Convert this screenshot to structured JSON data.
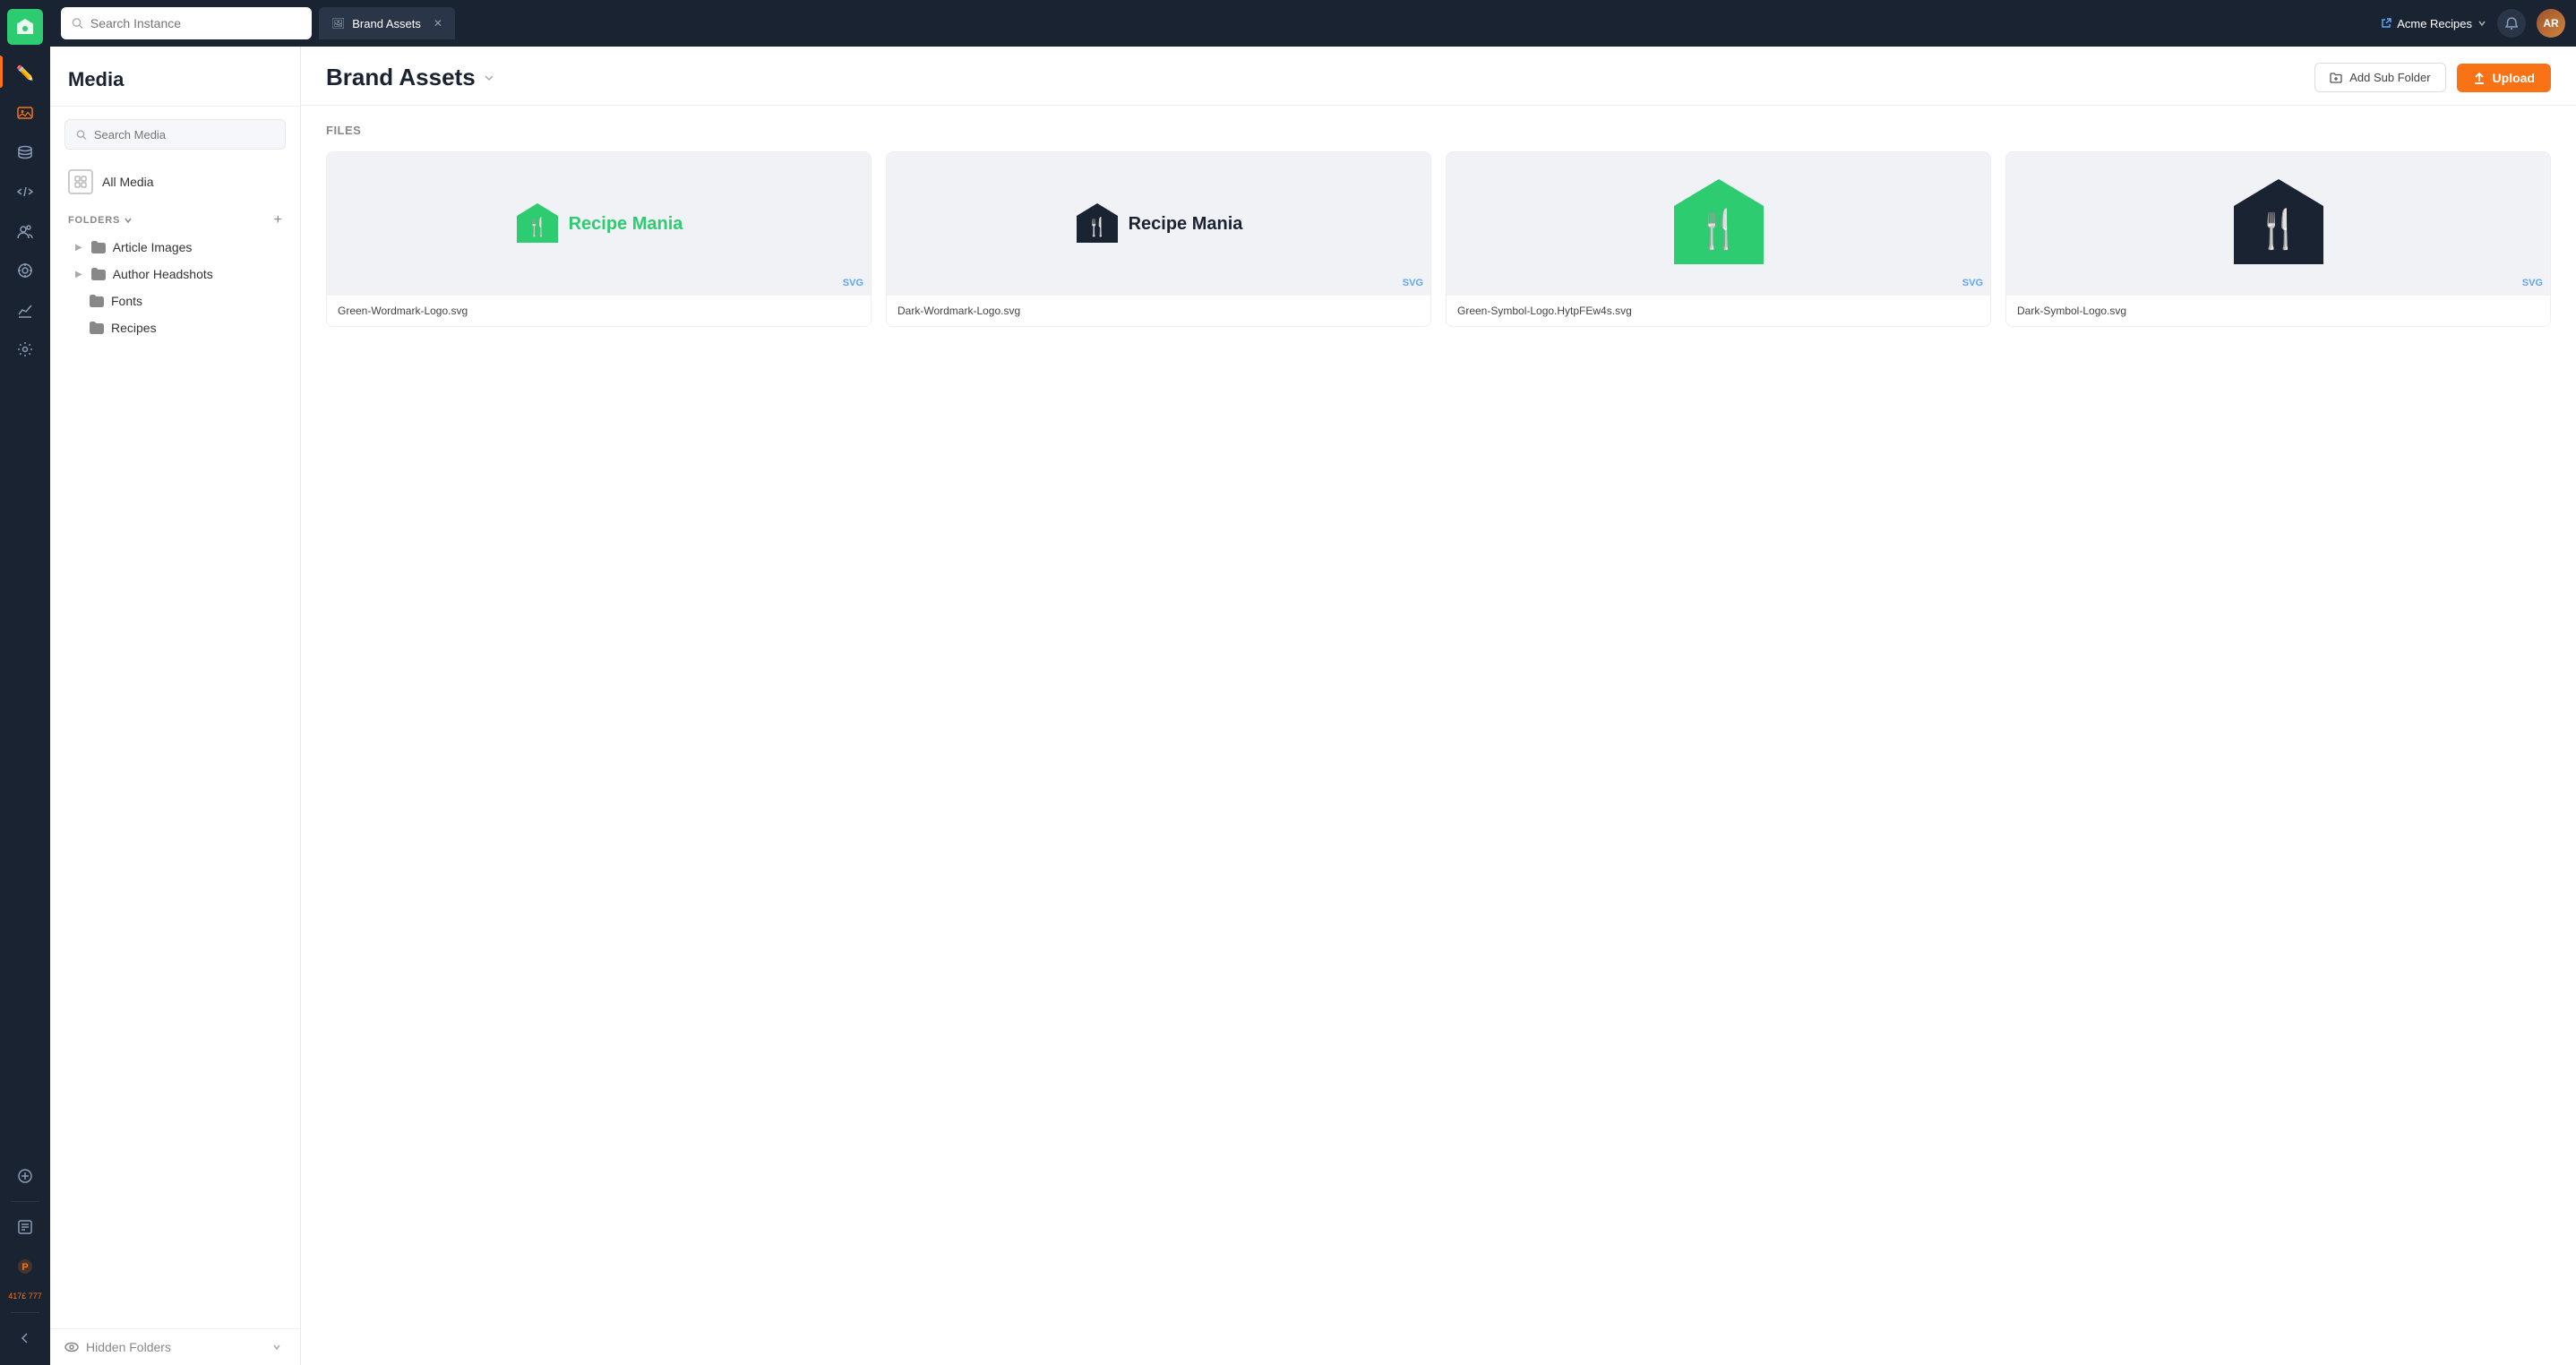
{
  "topbar": {
    "search_instance_placeholder": "Search Instance",
    "tab_label": "Brand Assets",
    "tab_icon": "🖼",
    "instance_name": "Acme Recipes",
    "instance_link_icon": "↗"
  },
  "left_panel": {
    "title": "Media",
    "search_placeholder": "Search Media",
    "all_media_label": "All Media",
    "folders_label": "FOLDERS",
    "folders": [
      {
        "name": "Article Images",
        "has_arrow": true
      },
      {
        "name": "Author Headshots",
        "has_arrow": true
      },
      {
        "name": "Fonts",
        "has_arrow": false
      },
      {
        "name": "Recipes",
        "has_arrow": false
      }
    ],
    "hidden_folders_label": "Hidden Folders"
  },
  "right_panel": {
    "title": "Brand Assets",
    "add_subfolder_label": "Add Sub Folder",
    "upload_label": "Upload",
    "files_section_label": "Files",
    "files": [
      {
        "name": "Green-Wordmark-Logo.svg",
        "badge": "SVG",
        "type": "green-wordmark"
      },
      {
        "name": "Dark-Wordmark-Logo.svg",
        "badge": "SVG",
        "type": "dark-wordmark"
      },
      {
        "name": "Green-Symbol-Logo.HytpFEw4s.svg",
        "badge": "SVG",
        "type": "green-symbol"
      },
      {
        "name": "Dark-Symbol-Logo.svg",
        "badge": "SVG",
        "type": "dark-symbol"
      }
    ]
  },
  "sidebar": {
    "items": [
      {
        "icon": "✏️",
        "name": "edit-icon"
      },
      {
        "icon": "🖼",
        "name": "media-icon",
        "active": true
      },
      {
        "icon": "⚙️",
        "name": "database-icon"
      },
      {
        "icon": "⌨️",
        "name": "code-icon"
      },
      {
        "icon": "👥",
        "name": "users-icon"
      },
      {
        "icon": "🎯",
        "name": "target-icon"
      },
      {
        "icon": "📊",
        "name": "analytics-icon"
      },
      {
        "icon": "⚙",
        "name": "settings-icon"
      }
    ],
    "bottom": [
      {
        "icon": "📋",
        "name": "log-icon"
      },
      {
        "icon": "🔴",
        "name": "plugin-icon",
        "highlighted": true
      },
      {
        "icon": "417£\n777",
        "name": "code-badge",
        "is_code": true
      }
    ],
    "collapse_icon": "❯"
  }
}
